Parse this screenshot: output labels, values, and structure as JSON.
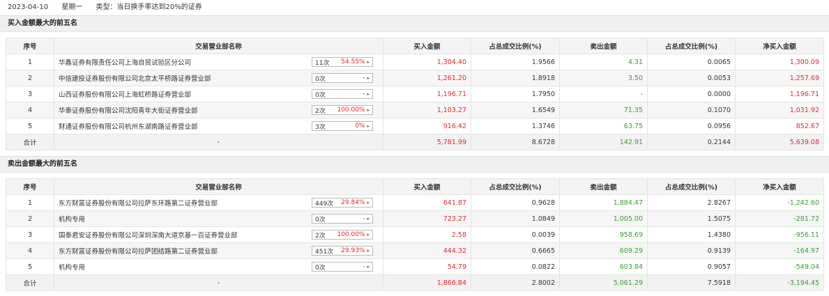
{
  "header": {
    "date": "2023-04-10",
    "weekday": "星期一",
    "type_label": "类型：当日换手率达到20%的证券"
  },
  "columns": [
    "序号",
    "交易营业部名称",
    "买入金额",
    "占总成交比例(%)",
    "卖出金额",
    "占总成交比例(%)",
    "净买入金额"
  ],
  "buy_section": {
    "title": "买入金额最大的前五名",
    "rows": [
      {
        "idx": "1",
        "name": "华鑫证券有限责任公司上海自贸试验区分公司",
        "times": "11次",
        "rate": "54.55%",
        "buy": "1,304.40",
        "buy_pct": "1.9566",
        "sell": "4.31",
        "sell_pct": "0.0065",
        "net": "1,300.09"
      },
      {
        "idx": "2",
        "name": "中信建投证券股份有限公司北京太平桥路证券营业部",
        "times": "0次",
        "rate": "-",
        "buy": "1,261.20",
        "buy_pct": "1.8918",
        "sell": "3.50",
        "sell_pct": "0.0053",
        "net": "1,257.69"
      },
      {
        "idx": "3",
        "name": "山西证券股份有限公司上海虹桥路证券营业部",
        "times": "0次",
        "rate": "-",
        "buy": "1,196.71",
        "buy_pct": "1.7950",
        "sell": "-",
        "sell_pct": "0.0000",
        "net": "1,196.71"
      },
      {
        "idx": "4",
        "name": "华泰证券股份有限公司沈阳青年大街证券营业部",
        "times": "2次",
        "rate": "100.00%",
        "buy": "1,103.27",
        "buy_pct": "1.6549",
        "sell": "71.35",
        "sell_pct": "0.1070",
        "net": "1,031.92"
      },
      {
        "idx": "5",
        "name": "财通证券股份有限公司杭州东湖南路证券营业部",
        "times": "3次",
        "rate": "0%",
        "buy": "916.42",
        "buy_pct": "1.3746",
        "sell": "63.75",
        "sell_pct": "0.0956",
        "net": "852.67"
      }
    ],
    "total": {
      "label": "合计",
      "name": "-",
      "buy": "5,781.99",
      "buy_pct": "8.6728",
      "sell": "142.91",
      "sell_pct": "0.2144",
      "net": "5,639.08"
    }
  },
  "sell_section": {
    "title": "卖出金额最大的前五名",
    "rows": [
      {
        "idx": "1",
        "name": "东方财富证券股份有限公司拉萨东环路第二证券营业部",
        "times": "449次",
        "rate": "29.84%",
        "buy": "641.87",
        "buy_pct": "0.9628",
        "sell": "1,884.47",
        "sell_pct": "2.8267",
        "net": "-1,242.60"
      },
      {
        "idx": "2",
        "name": "机构专用",
        "times": "0次",
        "rate": "-",
        "buy": "723.27",
        "buy_pct": "1.0849",
        "sell": "1,005.00",
        "sell_pct": "1.5075",
        "net": "-281.72"
      },
      {
        "idx": "3",
        "name": "国泰君安证券股份有限公司深圳深南大道京基一百证券营业部",
        "times": "2次",
        "rate": "100.00%",
        "buy": "2.58",
        "buy_pct": "0.0039",
        "sell": "958.69",
        "sell_pct": "1.4380",
        "net": "-956.11"
      },
      {
        "idx": "4",
        "name": "东方财富证券股份有限公司拉萨团结路第二证券营业部",
        "times": "451次",
        "rate": "29.93%",
        "buy": "444.32",
        "buy_pct": "0.6665",
        "sell": "609.29",
        "sell_pct": "0.9139",
        "net": "-164.97"
      },
      {
        "idx": "5",
        "name": "机构专用",
        "times": "0次",
        "rate": "-",
        "buy": "54.79",
        "buy_pct": "0.0822",
        "sell": "603.84",
        "sell_pct": "0.9057",
        "net": "-549.04"
      }
    ],
    "total": {
      "label": "合计",
      "name": "-",
      "buy": "1,866.84",
      "buy_pct": "2.8002",
      "sell": "5,061.29",
      "sell_pct": "7.5918",
      "net": "-3,194.45"
    }
  },
  "icons": {
    "dropdown": "chevron-right-icon"
  },
  "colors": {
    "positive": "#e3262a",
    "negative": "#3a9b2f"
  }
}
